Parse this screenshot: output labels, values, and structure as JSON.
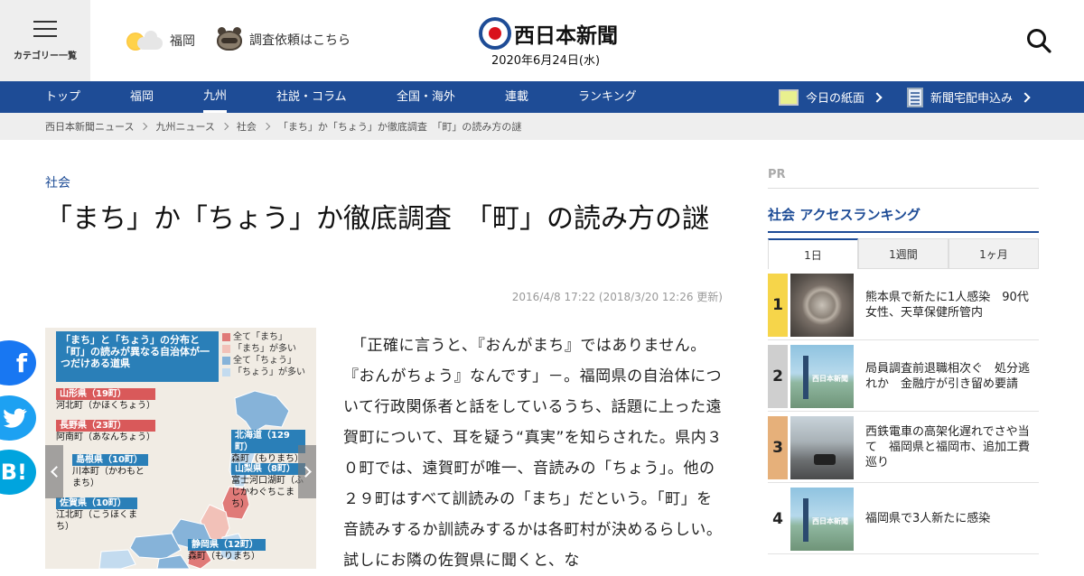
{
  "header": {
    "menu_label": "カテゴリー一覧",
    "weather_city": "福岡",
    "request_label": "調査依頼はこちら",
    "logo_text": "西日本新聞",
    "date": "2020年6月24日(水)"
  },
  "nav": {
    "items": [
      "トップ",
      "福岡",
      "九州",
      "社説・コラム",
      "全国・海外",
      "連載",
      "ランキング"
    ],
    "active": "九州",
    "today_paper": "今日の紙面",
    "subscribe": "新聞宅配申込み"
  },
  "breadcrumb": [
    "西日本新聞ニュース",
    "九州ニュース",
    "社会",
    "「まち」か「ちょう」か徹底調査　「町」の読み方の謎"
  ],
  "article": {
    "category": "社会",
    "title": "「まち」か「ちょう」か徹底調査　「町」の読み方の謎",
    "timestamp": "2016/4/8 17:22 (2018/3/20 12:26 更新)",
    "body": "　「正確に言うと、『おんがまち』ではありません。『おんがちょう』なんです」－。福岡県の自治体について行政関係者と話をしているうち、話題に上った遠賀町について、耳を疑う“真実”を知らされた。県内３０町では、遠賀町が唯一、音読みの「ちょう」。他の２９町はすべて訓読みの「まち」だという。「町」を音読みするか訓読みするかは各町村が決めるらしい。試しにお隣の佐賀県に聞くと、な"
  },
  "figure": {
    "header": "「まち」と「ちょう」の分布と「町」の読みが異なる自治体が一つだけある道県",
    "legend": [
      "全て「まち」",
      "「まち」が多い",
      "全て「ちょう」",
      "「ちょう」が多い"
    ],
    "legend_colors": [
      "#e07a78",
      "#f2c1b8",
      "#86b3d9",
      "#c3dbef"
    ],
    "labels": [
      {
        "name": "山形県（19町）",
        "town": "河北町（かほくちょう）",
        "color": "red"
      },
      {
        "name": "長野県（23町）",
        "town": "阿南町（あなんちょう）",
        "color": "red"
      },
      {
        "name": "島根県（10町）",
        "town": "川本町（かわもとまち）",
        "color": "blue"
      },
      {
        "name": "佐賀県（10町）",
        "town": "江北町（こうほくまち）",
        "color": "blue"
      },
      {
        "name": "北海道（129町）",
        "town": "森町（もりまち）",
        "color": "blue"
      },
      {
        "name": "山梨県（8町）",
        "town": "富士河口湖町（ふじかわぐちこまち）",
        "color": "blue"
      },
      {
        "name": "静岡県（12町）",
        "town": "森町（もりまち）",
        "color": "blue"
      }
    ]
  },
  "sidebar": {
    "pr": "PR",
    "ranking_title": "社会 アクセスランキング",
    "tabs": [
      "1日",
      "1週間",
      "1ヶ月"
    ],
    "active_tab": "1日",
    "items": [
      {
        "rank": "1",
        "text": "熊本県で新たに1人感染　90代女性、天草保健所管内",
        "rank_color": "#f6d54a",
        "thumb": "virus"
      },
      {
        "rank": "2",
        "text": "局員調査前退職相次ぐ　処分逃れか　金融庁が引き留め要請",
        "rank_color": "#cfcfcf",
        "thumb": "city"
      },
      {
        "rank": "3",
        "text": "西鉄電車の高架化遅れでさや当て　福岡県と福岡市、追加工費巡り",
        "rank_color": "#e6b07a",
        "thumb": "street"
      },
      {
        "rank": "4",
        "text": "福岡県で3人新たに感染",
        "rank_color": "#ffffff",
        "thumb": "city"
      }
    ],
    "thumb_label": "西日本新聞"
  },
  "colors": {
    "brand_blue": "#1e4c96",
    "logo_red": "#d9121c"
  }
}
